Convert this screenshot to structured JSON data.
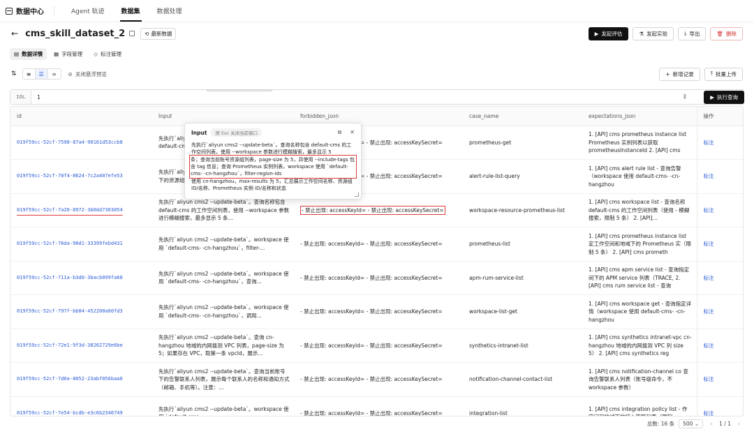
{
  "app": {
    "name": "数据中心",
    "nav": [
      "Agent 轨迹",
      "数据集",
      "数据处理"
    ],
    "active_nav": 1
  },
  "header": {
    "title": "cms_skill_dataset_2",
    "latest_label": "最新数据",
    "actions": {
      "evaluate": "发起评估",
      "experiment": "发起实验",
      "export": "导出",
      "delete": "删除"
    }
  },
  "subtabs": [
    "数据详情",
    "字段管理",
    "标注管理"
  ],
  "toolbar": {
    "hide_hover": "关闭悬浮预览",
    "add_record": "新增记录",
    "bulk_upload": "批量上传"
  },
  "query": {
    "limit": "10L",
    "text": "1",
    "run": "执行查询"
  },
  "table": {
    "columns": [
      "id",
      "Input",
      "forbidden_json",
      "case_name",
      "expectations_json",
      "操作"
    ],
    "rows": [
      {
        "id": "019f59cc-52cf-7598-87a4-90161d53ccb8",
        "input": "先执行`aliyun cms2 --update-beta`。查询名称包含 default-cms 的工作空间列表",
        "forbidden": "- 禁止出现: accessKeyId= - 禁止出现: accessKeySecret=",
        "case_name": "prometheus-get",
        "expect": "1. [API] cms prometheus instance list Prometheus 实例列表以获取 prometheusInstanceId 2. [API] cms",
        "op": "标注"
      },
      {
        "id": "019f59cc-52cf-70f4-8624-7c2a407efe53",
        "input": "先执行`aliyun cms2 --update-beta`。查询当前账号下的资源组列表 `default-cms-",
        "forbidden": "- 禁止出现: accessKeyId= - 禁止出现: accessKeySecret=",
        "case_name": "alert-rule-list-query",
        "expect": "1. [API] cms alert rule list - 查询告警（workspace 使用 default-cms- -cn-hangzhou",
        "op": "标注"
      },
      {
        "id": "019f59cc-52cf-7a20-8972-3b0dd7303054",
        "input": "先执行`aliyun cms2 --update-beta`。查询名称包含 default-cms 的工作空间列表，使用 --workspace 参数进行模糊搜索，最多显示 5 条...",
        "forbidden": "- 禁止出现: accessKeyId= - 禁止出现: accessKeySecret=",
        "case_name": "workspace-resource-prometheus-list",
        "expect": "1. [API] cms workspace list - 查询名称 default-cms 的工作空间列表（使用 - 模糊搜索，限制 5 条） 2. [API]...",
        "op": "标注"
      },
      {
        "id": "019f59cc-52cf-76da-90d1-33399febd431",
        "input": "先执行`aliyun cms2 --update-beta`。workspace 使用 `default-cms- -cn-hangzhou`，filter-...",
        "forbidden": "- 禁止出现: accessKeyId= - 禁止出现: accessKeySecret=",
        "case_name": "prometheus-list",
        "expect": "1. [API] cms prometheus instance list 定工作空间和地域下的 Prometheus 实（限制 5 条） 2. [API] cms prometh",
        "op": "标注"
      },
      {
        "id": "019f59cc-52cf-711a-b3d0-3bacb099fa68",
        "input": "先执行`aliyun cms2 --update-beta`。workspace 使用 `default-cms- -cn-hangzhou`，查询...",
        "forbidden": "- 禁止出现: accessKeyId= - 禁止出现: accessKeySecret=",
        "case_name": "apm-rum-service-list",
        "expect": "1. [API] cms apm service list - 查询指定间下的 APM service 列表（TRACE, 2. [API] cms rum service list - 查询",
        "op": "标注"
      },
      {
        "id": "019f59cc-52cf-797f-bb84-452200a60fd3",
        "input": "先执行`aliyun cms2 --update-beta`。workspace 使用 `default-cms- -cn-hangzhou`，调用...",
        "forbidden": "- 禁止出现: accessKeyId= - 禁止出现: accessKeySecret=",
        "case_name": "workspace-list-get",
        "expect": "1. [API] cms workspace get - 查询指定详情（workspace 使用 default-cms- -cn-hangzhou",
        "op": "标注"
      },
      {
        "id": "019f59cc-52cf-72e1-9f3d-38262729e6be",
        "input": "先执行`aliyun cms2 --update-beta`。查询 cn-hangzhou 地域的内网拨测 VPC 列表，page-size 为 5；如果存在 VPC，取第一条 vpcId，展示...",
        "forbidden": "- 禁止出现: accessKeyId= - 禁止出现: accessKeySecret=",
        "case_name": "synthetics-intranet-list",
        "expect": "1. [API] cms synthetics intranet-vpc cn-hangzhou 地域的内网拨测 VPC 列 size 5） 2. [API] cms synthetics reg",
        "op": "标注"
      },
      {
        "id": "019f59cc-52cf-7d0a-8052-23abf056baa0",
        "input": "先执行`aliyun cms2 --update-beta`。查询当前账号下的告警联系人列表，展示每个联系人的名称和通知方式（邮箱、手机等）。注意：...",
        "forbidden": "- 禁止出现: accessKeyId= - 禁止出现: accessKeySecret=",
        "case_name": "notification-channel-contact-list",
        "expect": "1. [API] cms notification-channel co 查询告警联系人列表（账号级命令，不 workspace 参数）",
        "op": "标注"
      },
      {
        "id": "019f59cc-52cf-7e54-bcdb-e3c6b2346749",
        "input": "先执行`aliyun cms2 --update-beta`。workspace 使用 `default-cms-",
        "forbidden": "- 禁止出现: accessKeyId= - 禁止出现: accessKeySecret=",
        "case_name": "integration-list",
        "expect": "1. [API] cms integration policy list - 作空间和地域下的接入策略列表（限制",
        "op": "标注"
      }
    ]
  },
  "popup": {
    "title": "Input",
    "hint": "按 Esc 关闭当前窗口",
    "text_top": "先执行`aliyun cms2 --update-beta`。查询名称包含 default-cms 的工作空间列表，使用 --workspace 参数进行模糊搜索，最多显示 5",
    "text_hl": "条；查询当前账号资源组列表，page-size 为 5，并使用 --include-tags 包含 tag 信息；查询 Prometheus 实例列表，workspace 使用 `default-cms- -cn-hangzhou`，filter-region-ids",
    "text_bottom": "使用 cn-hangzhou，max-results 为 5，汇总展示工作空间名称、资源组 ID/名称、Prometheus 实例 ID/名称和状态"
  },
  "pagination": {
    "total": "总数:  16 条",
    "page_size": "500",
    "page": "1 / 1"
  }
}
